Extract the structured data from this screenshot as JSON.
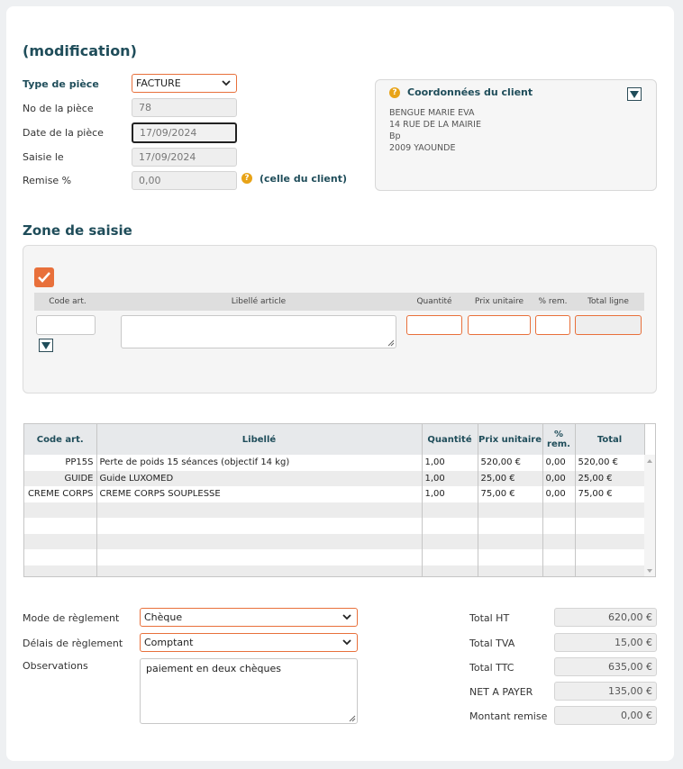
{
  "header": {
    "title": "(modification)"
  },
  "piece": {
    "type_label": "Type de pièce",
    "type_value": "FACTURE",
    "no_label": "No de la pièce",
    "no_value": "78",
    "date_label": "Date de la pièce",
    "date_value": "17/09/2024",
    "saisie_label": "Saisie le",
    "saisie_value": "17/09/2024",
    "remise_label": "Remise %",
    "remise_value": "0,00",
    "remise_note": "(celle du client)"
  },
  "client": {
    "title": "Coordonnées du client",
    "lines": [
      "BENGUE MARIE EVA",
      "14 RUE DE LA MAIRIE",
      "Bp",
      "2009 YAOUNDE"
    ]
  },
  "zone": {
    "title": "Zone de saisie",
    "col_code": "Code art.",
    "col_libelle": "Libellé article",
    "col_qte": "Quantité",
    "col_pu": "Prix unitaire",
    "col_rem": "% rem.",
    "col_total": "Total ligne"
  },
  "table": {
    "headers": [
      "Code art.",
      "Libellé",
      "Quantité",
      "Prix unitaire",
      "% rem.",
      "Total"
    ],
    "rows": [
      [
        "PP15S",
        "Perte de poids 15 séances (objectif 14 kg)",
        "1,00",
        "520,00 €",
        "0,00",
        "520,00 €"
      ],
      [
        "GUIDE",
        "Guide LUXOMED",
        "1,00",
        "25,00 €",
        "0,00",
        "25,00 €"
      ],
      [
        "CREME CORPS",
        "CREME CORPS SOUPLESSE",
        "1,00",
        "75,00 €",
        "0,00",
        "75,00 €"
      ],
      [
        "",
        "",
        "",
        "",
        "",
        ""
      ],
      [
        "",
        "",
        "",
        "",
        "",
        ""
      ],
      [
        "",
        "",
        "",
        "",
        "",
        ""
      ],
      [
        "",
        "",
        "",
        "",
        "",
        ""
      ],
      [
        "",
        "",
        "",
        "",
        "",
        ""
      ]
    ]
  },
  "reglement": {
    "mode_label": "Mode de règlement",
    "mode_value": "Chèque",
    "delai_label": "Délais de règlement",
    "delai_value": "Comptant",
    "obs_label": "Observations",
    "obs_value": "paiement en deux chèques"
  },
  "totals": {
    "ht_label": "Total HT",
    "ht_value": "620,00 €",
    "tva_label": "Total TVA",
    "tva_value": "15,00 €",
    "ttc_label": "Total TTC",
    "ttc_value": "635,00 €",
    "net_label": "NET A PAYER",
    "net_value": "135,00 €",
    "remise_label": "Montant remise",
    "remise_value": "0,00 €"
  },
  "colors": {
    "accent": "#e8703b",
    "heading": "#1f4d5a",
    "help": "#e8a317"
  },
  "icons": {
    "help": "question-circle-icon",
    "dropdown": "caret-down-icon",
    "check": "checkbox-checked-icon"
  }
}
